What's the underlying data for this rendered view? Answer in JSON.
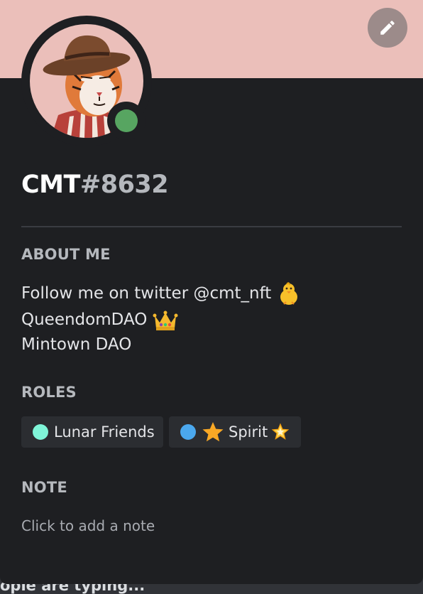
{
  "profile": {
    "username": "CMT",
    "discriminator": "#8632",
    "status": "online",
    "status_color": "#57a561",
    "banner_color": "#ebbfba"
  },
  "about": {
    "title": "ABOUT ME",
    "lines": [
      "Follow me on twitter @cmt_nft",
      "QueendomDAO",
      "Mintown DAO"
    ]
  },
  "roles": {
    "title": "ROLES",
    "items": [
      {
        "label": "Lunar Friends",
        "color": "#7ff5d8"
      },
      {
        "label": "Spirit",
        "color": "#4ba8ee"
      }
    ]
  },
  "note": {
    "title": "NOTE",
    "placeholder": "Click to add a note"
  },
  "footer": {
    "typing_text": "ople are typing..."
  },
  "icons": {
    "edit": "pencil-icon",
    "chick": "baby-chick-emoji",
    "crown": "crown-emoji",
    "star": "star-emoji",
    "glowing_star": "glowing-star-emoji"
  }
}
